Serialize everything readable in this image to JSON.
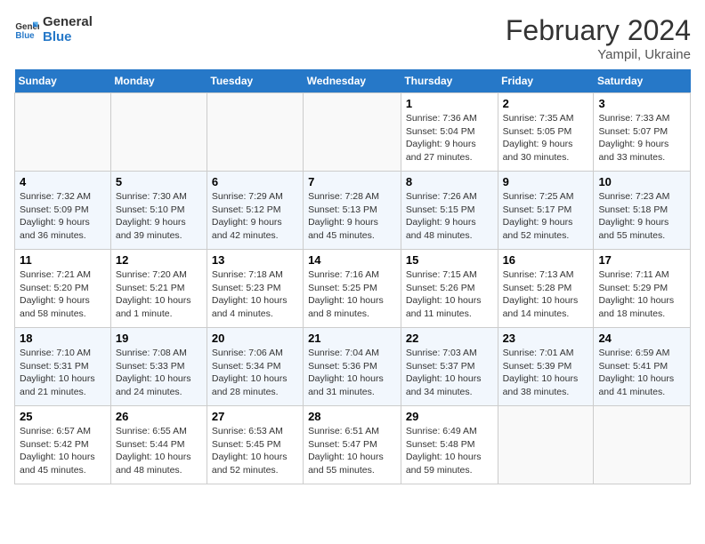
{
  "header": {
    "logo_line1": "General",
    "logo_line2": "Blue",
    "month_title": "February 2024",
    "location": "Yampil, Ukraine"
  },
  "weekdays": [
    "Sunday",
    "Monday",
    "Tuesday",
    "Wednesday",
    "Thursday",
    "Friday",
    "Saturday"
  ],
  "weeks": [
    [
      {
        "day": "",
        "sunrise": "",
        "sunset": "",
        "daylight": "",
        "empty": true
      },
      {
        "day": "",
        "sunrise": "",
        "sunset": "",
        "daylight": "",
        "empty": true
      },
      {
        "day": "",
        "sunrise": "",
        "sunset": "",
        "daylight": "",
        "empty": true
      },
      {
        "day": "",
        "sunrise": "",
        "sunset": "",
        "daylight": "",
        "empty": true
      },
      {
        "day": "1",
        "sunrise": "7:36 AM",
        "sunset": "5:04 PM",
        "daylight": "9 hours and 27 minutes."
      },
      {
        "day": "2",
        "sunrise": "7:35 AM",
        "sunset": "5:05 PM",
        "daylight": "9 hours and 30 minutes."
      },
      {
        "day": "3",
        "sunrise": "7:33 AM",
        "sunset": "5:07 PM",
        "daylight": "9 hours and 33 minutes."
      }
    ],
    [
      {
        "day": "4",
        "sunrise": "7:32 AM",
        "sunset": "5:09 PM",
        "daylight": "9 hours and 36 minutes."
      },
      {
        "day": "5",
        "sunrise": "7:30 AM",
        "sunset": "5:10 PM",
        "daylight": "9 hours and 39 minutes."
      },
      {
        "day": "6",
        "sunrise": "7:29 AM",
        "sunset": "5:12 PM",
        "daylight": "9 hours and 42 minutes."
      },
      {
        "day": "7",
        "sunrise": "7:28 AM",
        "sunset": "5:13 PM",
        "daylight": "9 hours and 45 minutes."
      },
      {
        "day": "8",
        "sunrise": "7:26 AM",
        "sunset": "5:15 PM",
        "daylight": "9 hours and 48 minutes."
      },
      {
        "day": "9",
        "sunrise": "7:25 AM",
        "sunset": "5:17 PM",
        "daylight": "9 hours and 52 minutes."
      },
      {
        "day": "10",
        "sunrise": "7:23 AM",
        "sunset": "5:18 PM",
        "daylight": "9 hours and 55 minutes."
      }
    ],
    [
      {
        "day": "11",
        "sunrise": "7:21 AM",
        "sunset": "5:20 PM",
        "daylight": "9 hours and 58 minutes."
      },
      {
        "day": "12",
        "sunrise": "7:20 AM",
        "sunset": "5:21 PM",
        "daylight": "10 hours and 1 minute."
      },
      {
        "day": "13",
        "sunrise": "7:18 AM",
        "sunset": "5:23 PM",
        "daylight": "10 hours and 4 minutes."
      },
      {
        "day": "14",
        "sunrise": "7:16 AM",
        "sunset": "5:25 PM",
        "daylight": "10 hours and 8 minutes."
      },
      {
        "day": "15",
        "sunrise": "7:15 AM",
        "sunset": "5:26 PM",
        "daylight": "10 hours and 11 minutes."
      },
      {
        "day": "16",
        "sunrise": "7:13 AM",
        "sunset": "5:28 PM",
        "daylight": "10 hours and 14 minutes."
      },
      {
        "day": "17",
        "sunrise": "7:11 AM",
        "sunset": "5:29 PM",
        "daylight": "10 hours and 18 minutes."
      }
    ],
    [
      {
        "day": "18",
        "sunrise": "7:10 AM",
        "sunset": "5:31 PM",
        "daylight": "10 hours and 21 minutes."
      },
      {
        "day": "19",
        "sunrise": "7:08 AM",
        "sunset": "5:33 PM",
        "daylight": "10 hours and 24 minutes."
      },
      {
        "day": "20",
        "sunrise": "7:06 AM",
        "sunset": "5:34 PM",
        "daylight": "10 hours and 28 minutes."
      },
      {
        "day": "21",
        "sunrise": "7:04 AM",
        "sunset": "5:36 PM",
        "daylight": "10 hours and 31 minutes."
      },
      {
        "day": "22",
        "sunrise": "7:03 AM",
        "sunset": "5:37 PM",
        "daylight": "10 hours and 34 minutes."
      },
      {
        "day": "23",
        "sunrise": "7:01 AM",
        "sunset": "5:39 PM",
        "daylight": "10 hours and 38 minutes."
      },
      {
        "day": "24",
        "sunrise": "6:59 AM",
        "sunset": "5:41 PM",
        "daylight": "10 hours and 41 minutes."
      }
    ],
    [
      {
        "day": "25",
        "sunrise": "6:57 AM",
        "sunset": "5:42 PM",
        "daylight": "10 hours and 45 minutes."
      },
      {
        "day": "26",
        "sunrise": "6:55 AM",
        "sunset": "5:44 PM",
        "daylight": "10 hours and 48 minutes."
      },
      {
        "day": "27",
        "sunrise": "6:53 AM",
        "sunset": "5:45 PM",
        "daylight": "10 hours and 52 minutes."
      },
      {
        "day": "28",
        "sunrise": "6:51 AM",
        "sunset": "5:47 PM",
        "daylight": "10 hours and 55 minutes."
      },
      {
        "day": "29",
        "sunrise": "6:49 AM",
        "sunset": "5:48 PM",
        "daylight": "10 hours and 59 minutes."
      },
      {
        "day": "",
        "sunrise": "",
        "sunset": "",
        "daylight": "",
        "empty": true
      },
      {
        "day": "",
        "sunrise": "",
        "sunset": "",
        "daylight": "",
        "empty": true
      }
    ]
  ],
  "labels": {
    "sunrise": "Sunrise:",
    "sunset": "Sunset:",
    "daylight": "Daylight:"
  }
}
